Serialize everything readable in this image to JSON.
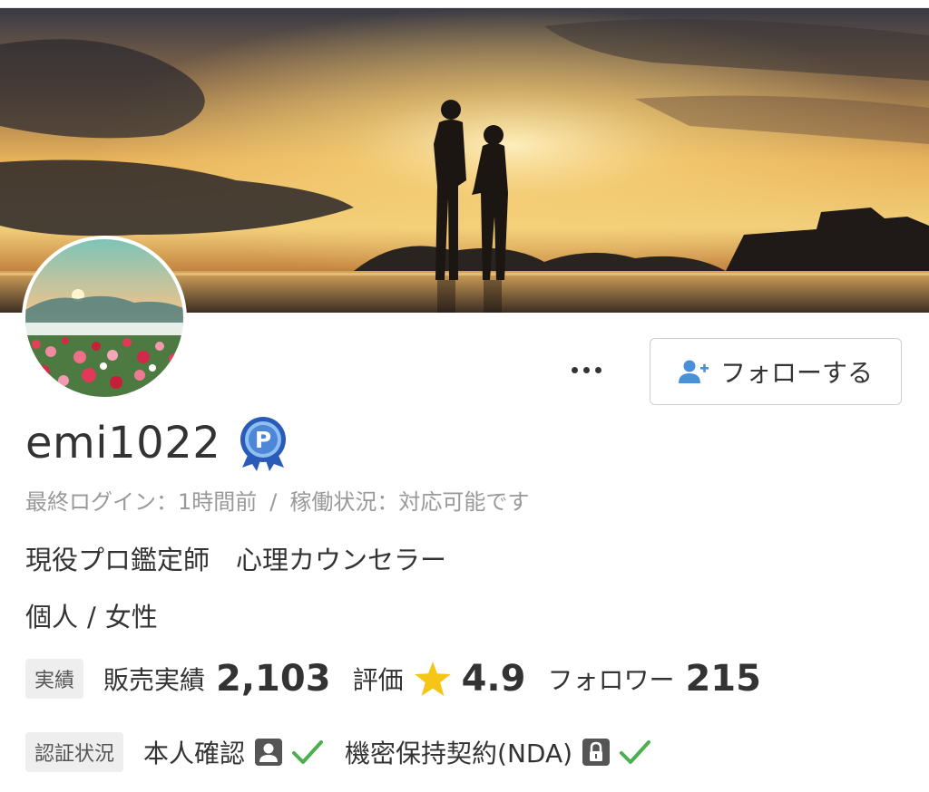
{
  "profile": {
    "username": "emi1022",
    "badge_icon": "platinum-badge-icon",
    "last_login_label": "最終ログイン：1時間前",
    "separator": "/",
    "activity_status_label": "稼働状況：対応可能です",
    "tagline": "現役プロ鑑定師　心理カウンセラー",
    "type": "個人",
    "gender": "女性"
  },
  "actions": {
    "more_icon": "more-horizontal-icon",
    "follow_label": "フォローする",
    "follow_icon": "user-plus-icon"
  },
  "stats": {
    "tag": "実績",
    "sales_label": "販売実績",
    "sales_value": "2,103",
    "rating_label": "評価",
    "rating_value": "4.9",
    "followers_label": "フォロワー",
    "followers_value": "215"
  },
  "verification": {
    "tag": "認証状況",
    "identity_label": "本人確認",
    "nda_label": "機密保持契約(NDA)"
  },
  "colors": {
    "accent_blue": "#4a90d9",
    "check_green": "#4caf50",
    "star_yellow": "#f5c518",
    "text": "#333333",
    "muted": "#999999"
  }
}
